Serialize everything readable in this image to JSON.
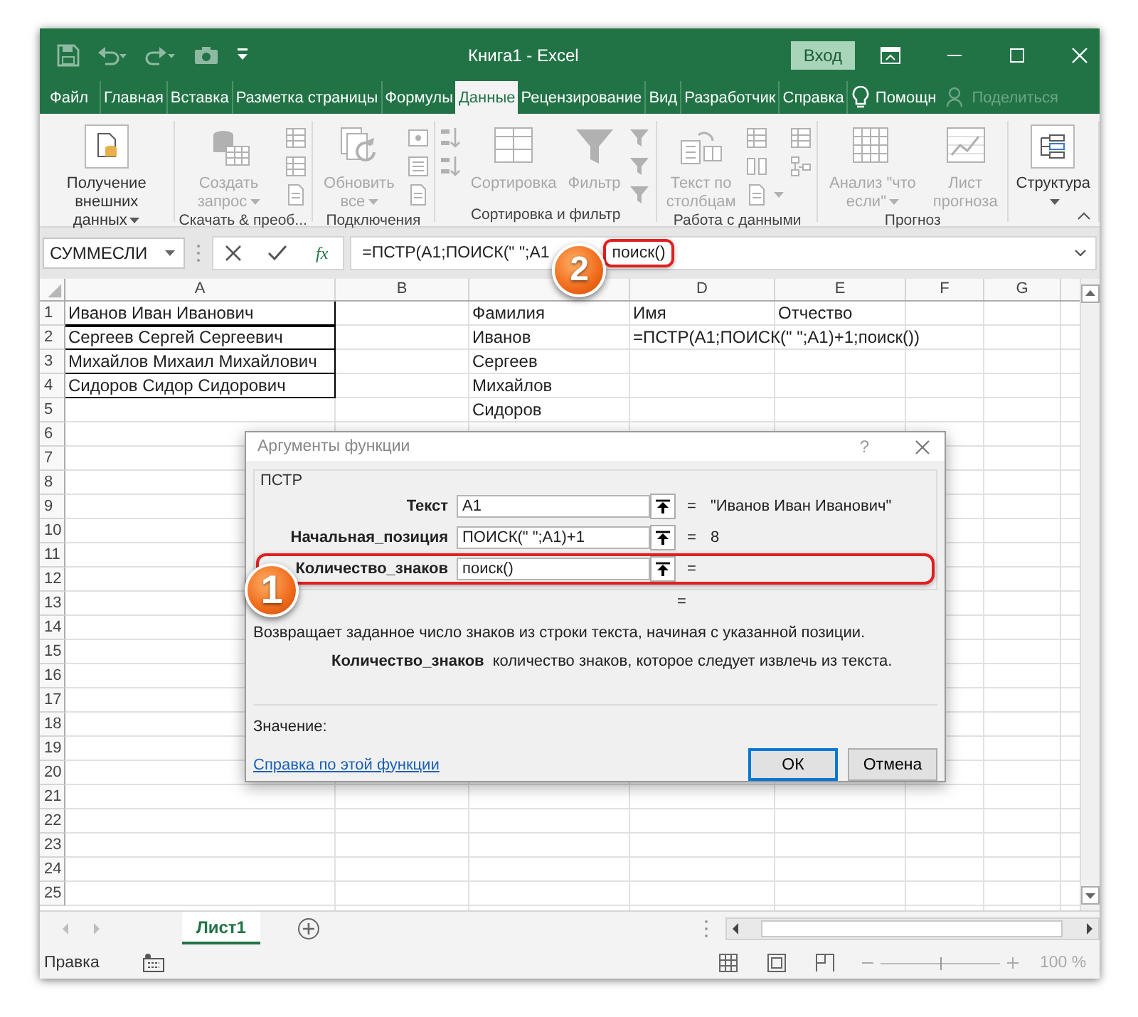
{
  "window": {
    "title": "Книга1  -  Excel",
    "sign_in_button": "Вход"
  },
  "tabs": [
    {
      "label": "Файл",
      "selected": false
    },
    {
      "label": "Главная",
      "selected": false
    },
    {
      "label": "Вставка",
      "selected": false
    },
    {
      "label": "Разметка страницы",
      "selected": false
    },
    {
      "label": "Формулы",
      "selected": false
    },
    {
      "label": "Данные",
      "selected": true
    },
    {
      "label": "Рецензирование",
      "selected": false
    },
    {
      "label": "Вид",
      "selected": false
    },
    {
      "label": "Разработчик",
      "selected": false
    },
    {
      "label": "Справка",
      "selected": false
    }
  ],
  "help": {
    "label": "Помощн"
  },
  "share": {
    "label": "Поделиться",
    "disabled": true
  },
  "ribbon": {
    "groups": [
      {
        "items": [
          {
            "kind": "large",
            "label": "Получение внешних данных",
            "disabled": false,
            "dropdown": true
          }
        ]
      },
      {
        "label": "Скачать & преоб...",
        "items": [
          {
            "kind": "large",
            "label": "Создать запрос",
            "disabled": true,
            "dropdown": true
          },
          {
            "kind": "stack",
            "buttons": [
              {
                "disabled": true,
                "dropdown": false
              },
              {
                "disabled": true,
                "dropdown": false
              },
              {
                "disabled": true,
                "dropdown": false
              }
            ]
          }
        ]
      },
      {
        "label": "Подключения",
        "items": [
          {
            "kind": "large",
            "label": "Обновить все",
            "disabled": true,
            "dropdown": true
          },
          {
            "kind": "stack",
            "buttons": [
              {
                "disabled": true,
                "dropdown": false
              },
              {
                "disabled": true,
                "dropdown": false
              },
              {
                "disabled": true,
                "dropdown": false
              }
            ]
          }
        ]
      },
      {
        "label": "Сортировка и фильтр",
        "items": [
          {
            "kind": "stack",
            "buttons": [
              {
                "disabled": true,
                "dropdown": false
              },
              {
                "disabled": true,
                "dropdown": false
              }
            ]
          },
          {
            "kind": "large",
            "label": "Сортировка",
            "disabled": true,
            "dropdown": false
          },
          {
            "kind": "large",
            "label": "Фильтр",
            "disabled": true,
            "dropdown": false
          },
          {
            "kind": "stack",
            "buttons": [
              {
                "disabled": true,
                "dropdown": false
              },
              {
                "disabled": true,
                "dropdown": false
              },
              {
                "disabled": true,
                "dropdown": false
              }
            ]
          }
        ]
      },
      {
        "label": "Работа с данными",
        "items": [
          {
            "kind": "large",
            "label": "Текст по столбцам",
            "disabled": true,
            "dropdown": false
          },
          {
            "kind": "stack",
            "buttons": [
              {
                "disabled": true,
                "dropdown": false
              },
              {
                "disabled": true,
                "dropdown": false
              },
              {
                "disabled": true,
                "dropdown": true
              }
            ]
          },
          {
            "kind": "stack",
            "buttons": [
              {
                "disabled": true,
                "dropdown": false
              },
              {
                "disabled": true,
                "dropdown": false
              }
            ]
          }
        ]
      },
      {
        "label": "Прогноз",
        "items": [
          {
            "kind": "large",
            "label": "Анализ \"что если\"",
            "disabled": true,
            "dropdown": true
          },
          {
            "kind": "large",
            "label": "Лист прогноза",
            "disabled": true,
            "dropdown": false
          }
        ]
      },
      {
        "items": [
          {
            "kind": "large",
            "label": "Структура",
            "disabled": false,
            "dropdown": true
          }
        ]
      }
    ]
  },
  "formula_bar": {
    "name_box": "СУММЕСЛИ",
    "function_button": "fx",
    "formula": "=ПСТР(A1;ПОИСК(\" \";A1",
    "formula_highlighted": "поиск()",
    "callout": "2"
  },
  "sheet": {
    "columns": [
      "A",
      "B",
      null,
      "D",
      "E",
      "F",
      "G"
    ],
    "rows": [
      {
        "number": "1",
        "cells": [
          "Иванов Иван Иванович",
          null,
          "Фамилия",
          "Имя",
          "Отчество",
          null,
          null
        ],
        "outlined": true
      },
      {
        "number": "2",
        "cells": [
          "Сергеев Сергей Сергеевич",
          null,
          "Иванов",
          "=ПСТР(A1;ПОИСК(\" \";A1)+1;поиск())",
          null,
          null,
          null
        ],
        "outlined": true
      },
      {
        "number": "3",
        "cells": [
          "Михайлов Михаил Михайлович",
          null,
          "Сергеев",
          null,
          null,
          null,
          null
        ],
        "outlined": true
      },
      {
        "number": "4",
        "cells": [
          "Сидоров Сидор Сидорович",
          null,
          "Михайлов",
          null,
          null,
          null,
          null
        ],
        "outlined": true
      },
      {
        "number": "5",
        "cells": [
          null,
          null,
          "Сидоров",
          null,
          null,
          null,
          null
        ],
        "outlined": false
      },
      {
        "number": "6",
        "outlined": false
      },
      {
        "number": "7",
        "outlined": false
      },
      {
        "number": "8",
        "outlined": false
      },
      {
        "number": "9",
        "outlined": false
      },
      {
        "number": "10",
        "outlined": false
      },
      {
        "number": "11",
        "outlined": false
      },
      {
        "number": "12",
        "outlined": false
      },
      {
        "number": "13",
        "outlined": false
      },
      {
        "number": "14",
        "outlined": false
      },
      {
        "number": "15",
        "outlined": false
      },
      {
        "number": "16",
        "outlined": false
      },
      {
        "number": "17",
        "outlined": false
      },
      {
        "number": "18",
        "outlined": false
      },
      {
        "number": "19",
        "outlined": false
      },
      {
        "number": "20",
        "outlined": false
      },
      {
        "number": "21",
        "outlined": false
      },
      {
        "number": "22",
        "outlined": false
      },
      {
        "number": "23",
        "outlined": false
      },
      {
        "number": "24",
        "outlined": false
      },
      {
        "number": "25",
        "outlined": false
      }
    ]
  },
  "dialog": {
    "title": "Аргументы функции",
    "help_button": "?",
    "function_name": "ПСТР",
    "callout": "1",
    "arguments": [
      {
        "label": "Текст",
        "value": "A1",
        "equals": "=",
        "result": "\"Иванов Иван Иванович\"",
        "highlighted": false
      },
      {
        "label": "Начальная_позиция",
        "value": "ПОИСК(\" \";A1)+1",
        "equals": "=",
        "result": "8",
        "highlighted": false
      },
      {
        "label": "Количество_знаков",
        "value": "поиск()",
        "equals": "=",
        "highlighted": true
      }
    ],
    "formula_result_equals": "=",
    "description": "Возвращает заданное число знаков из строки текста, начиная с указанной позиции.",
    "argument_name": "Количество_знаков",
    "argument_help": "количество знаков, которое следует извлечь из текста.",
    "value_label": "Значение:",
    "help_link": "Справка по этой функции",
    "buttons": [
      {
        "label": "ОК",
        "focused": true
      },
      {
        "label": "Отмена",
        "focused": false
      }
    ]
  },
  "sheet_tabs": [
    {
      "label": "Лист1",
      "selected": true
    }
  ],
  "status_bar": {
    "mode": "Правка",
    "zoom": "100 %",
    "zoom_level": {
      "level": 0.5
    }
  }
}
